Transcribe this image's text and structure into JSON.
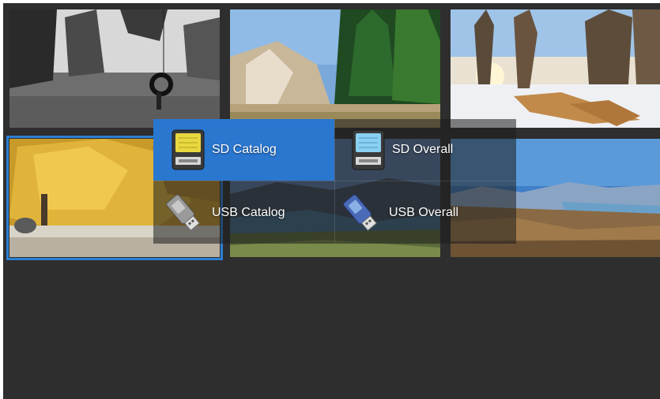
{
  "gallery": {
    "thumbnails": [
      {
        "id": "tree-swing",
        "selected": false
      },
      {
        "id": "frosty-forest",
        "selected": false
      },
      {
        "id": "snowy-sunset",
        "selected": false
      },
      {
        "id": "golden-willow",
        "selected": true
      },
      {
        "id": "mountain-lake",
        "selected": false
      },
      {
        "id": "alpine-valley",
        "selected": false
      }
    ],
    "selection_color": "#2b7fd3",
    "background_color": "#2e2e2e"
  },
  "menu": {
    "highlight_color": "#2a77d0",
    "items": [
      {
        "label": "SD Catalog",
        "icon": "sd-card-icon",
        "active": true
      },
      {
        "label": "SD Overall",
        "icon": "sd-card-icon",
        "active": false
      },
      {
        "label": "USB Catalog",
        "icon": "usb-drive-icon",
        "active": false
      },
      {
        "label": "USB Overall",
        "icon": "usb-drive-icon",
        "active": false
      }
    ]
  }
}
